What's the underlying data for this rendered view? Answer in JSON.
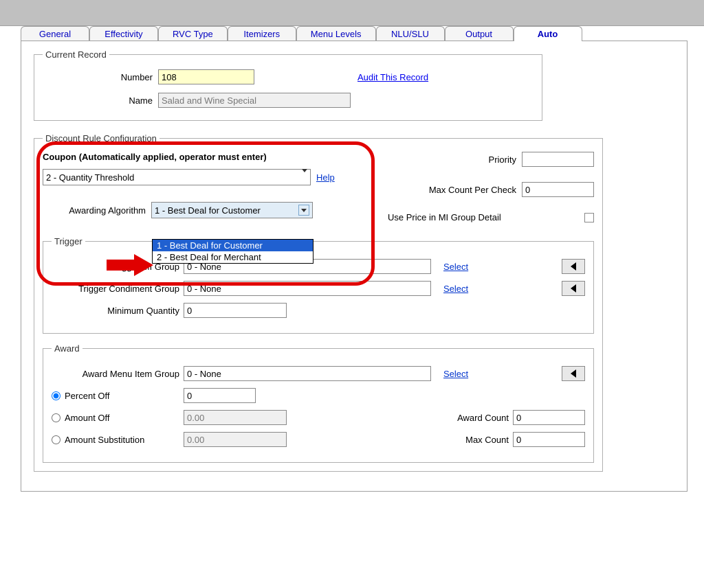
{
  "tabs": [
    "General",
    "Effectivity",
    "RVC Type",
    "Itemizers",
    "Menu Levels",
    "NLU/SLU",
    "Output",
    "Auto"
  ],
  "activeTab": "Auto",
  "currentRecord": {
    "legend": "Current Record",
    "numberLabel": "Number",
    "numberValue": "108",
    "nameLabel": "Name",
    "nameValue": "Salad and Wine Special",
    "auditLink": "Audit This Record"
  },
  "ruleConfig": {
    "legend": "Discount Rule Configuration",
    "headline": "Coupon (Automatically applied, operator must enter)",
    "typeSelected": "2 - Quantity Threshold",
    "helpLabel": "Help",
    "priorityLabel": "Priority",
    "priorityValue": "",
    "maxCountLabel": "Max Count Per Check",
    "maxCountValue": "0",
    "usePriceLabel": "Use Price in MI Group Detail",
    "usePriceChecked": false,
    "algorithm": {
      "label": "Awarding Algorithm",
      "selected": "1 - Best Deal for Customer",
      "options": [
        "1 - Best Deal for Customer",
        "2 - Best Deal for Merchant"
      ]
    }
  },
  "trigger": {
    "legend": "Trigger",
    "miGroupLabel": "Trigger MI Group",
    "miGroupValue": "0 - None",
    "condGroupLabel": "Trigger Condiment Group",
    "condGroupValue": "0 - None",
    "minQtyLabel": "Minimum Quantity",
    "minQtyValue": "0",
    "selectLabel": "Select"
  },
  "award": {
    "legend": "Award",
    "menuItemGroupLabel": "Award Menu Item Group",
    "menuItemGroupValue": "0 - None",
    "selectLabel": "Select",
    "percentOffLabel": "Percent Off",
    "percentOffValue": "0",
    "amountOffLabel": "Amount Off",
    "amountOffValue": "0.00",
    "amountSubLabel": "Amount Substitution",
    "amountSubValue": "0.00",
    "awardCountLabel": "Award Count",
    "awardCountValue": "0",
    "maxCountLabel": "Max Count",
    "maxCountValue": "0",
    "selectedRadio": "percent"
  }
}
